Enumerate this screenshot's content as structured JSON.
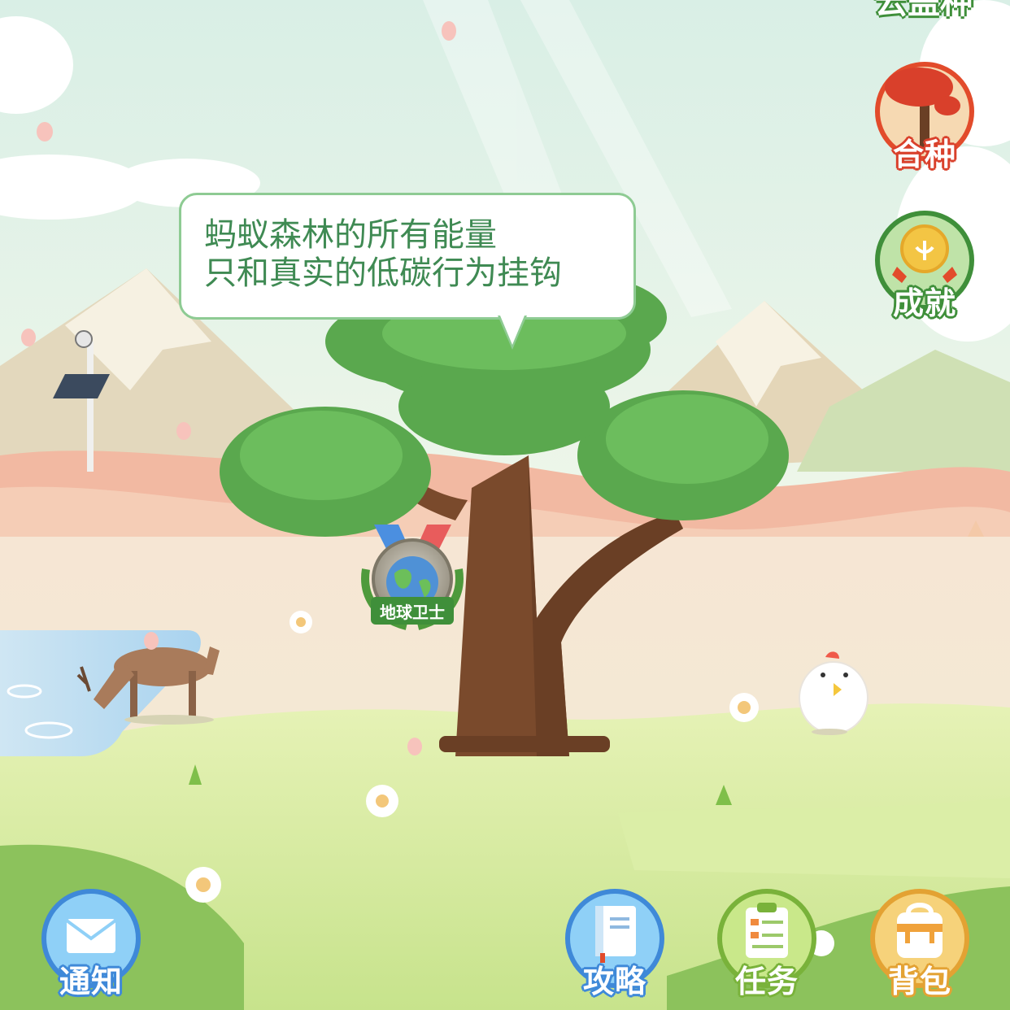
{
  "top_cut_label": "云盖种",
  "speech_bubble": {
    "line1": "蚂蚁森林的所有能量",
    "line2": "只和真实的低碳行为挂钩"
  },
  "medal": {
    "label": "地球卫士"
  },
  "right_menu": {
    "hezhong_label": "合种",
    "chengjiu_label": "成就"
  },
  "bottom_bar": {
    "notify_label": "通知",
    "guide_label": "攻略",
    "task_label": "任务",
    "bag_label": "背包"
  },
  "colors": {
    "sky": "#dff0e6",
    "bubble_text": "#3f8a53",
    "bubble_border": "#8ecb93",
    "hezhong_ring": "#e24b2b",
    "chengjiu_ring": "#3f8f3a",
    "notify_ring": "#3f89d8",
    "task_ring": "#79b23a",
    "bag_ring": "#e3a233"
  }
}
